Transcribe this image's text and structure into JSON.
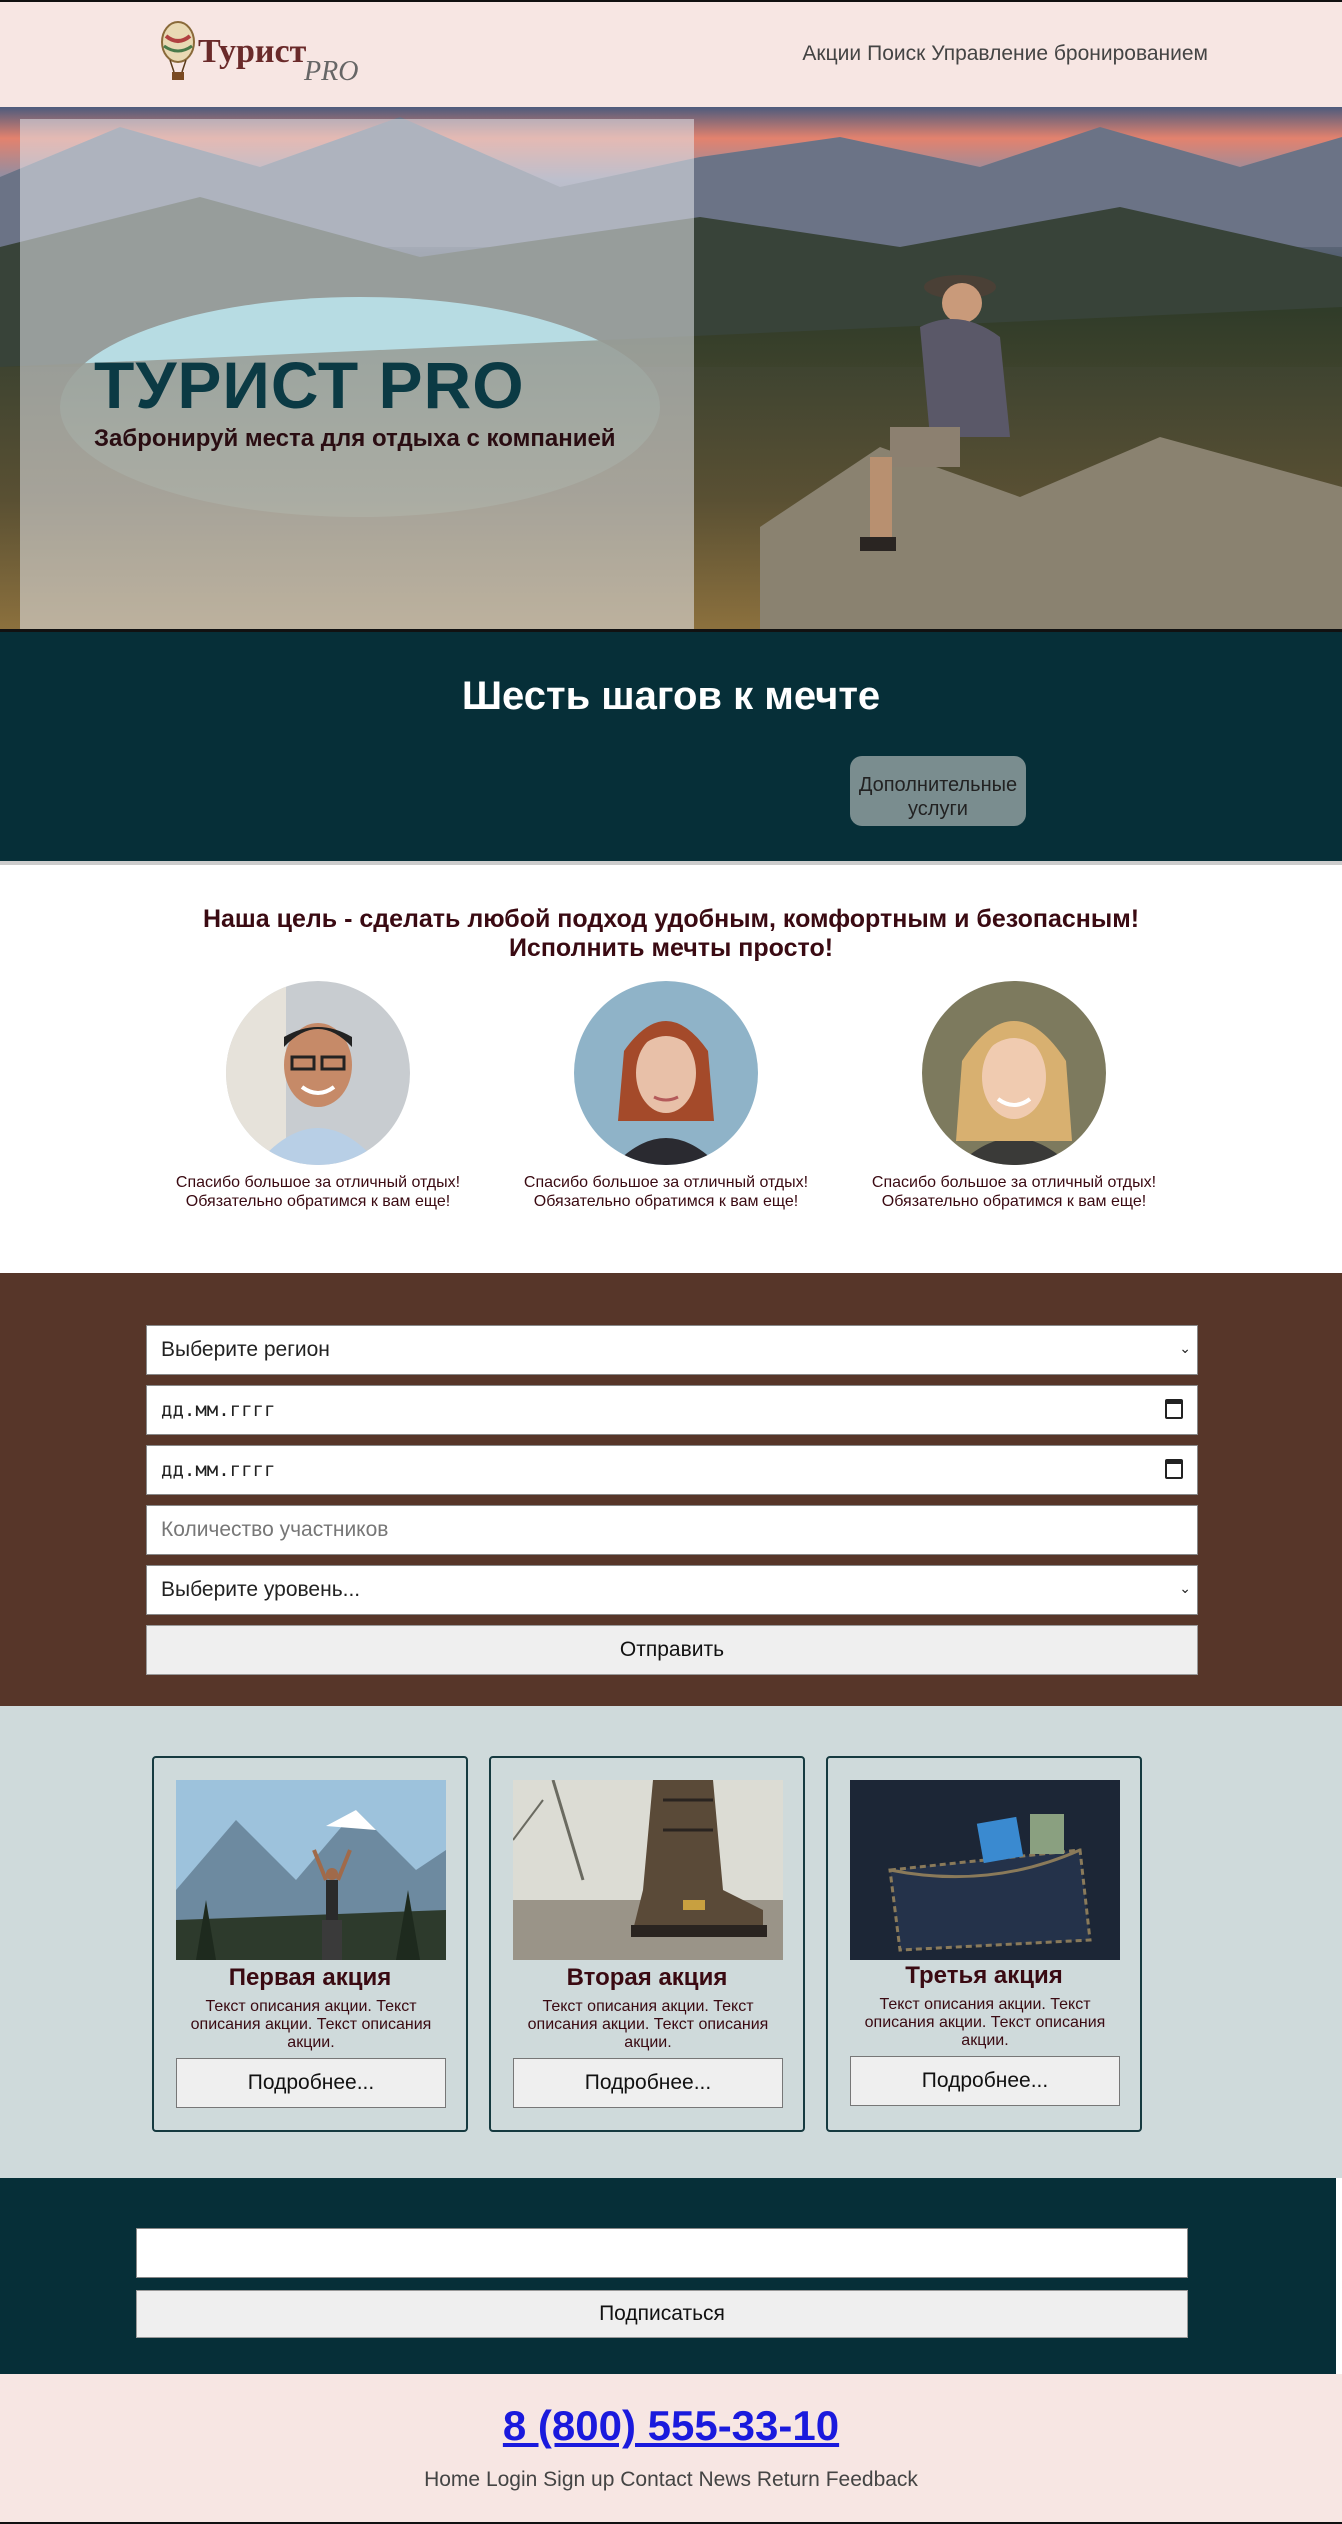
{
  "header": {
    "logo_text_main": "Турист",
    "logo_text_suffix": "PRO",
    "nav": [
      "Акции",
      "Поиск",
      "Управление бронированием"
    ]
  },
  "hero": {
    "title": "ТУРИСТ PRO",
    "subtitle": "Забронируй места для отдыха с компанией"
  },
  "steps": {
    "title": "Шесть шагов к мечте",
    "extra_button": "Дополнительные услуги"
  },
  "reviews": {
    "goal_line1": "Наша цель - сделать любой подход удобным, комфортным и безопасным!",
    "goal_line2": "Исполнить мечты просто!",
    "items": [
      {
        "line1": "Спасибо большое за отличный отдых!",
        "line2": "Обязательно обратимся к вам еще!"
      },
      {
        "line1": "Спасибо большое за отличный отдых!",
        "line2": "Обязательно обратимся к вам еще!"
      },
      {
        "line1": "Спасибо большое за отличный отдых!",
        "line2": "Обязательно обратимся к вам еще!"
      }
    ]
  },
  "form": {
    "region_select": "Выберите регион",
    "date_from_placeholder": "дд.мм.гггг",
    "date_to_placeholder": "дд.мм.гггг",
    "participants_placeholder": "Количество участников",
    "level_select": "Выберите уровень...",
    "submit_label": "Отправить"
  },
  "promos": [
    {
      "title": "Первая акция",
      "desc": "Текст описания акции. Текст описания акции. Текст описания акции.",
      "button": "Подробнее..."
    },
    {
      "title": "Вторая акция",
      "desc": "Текст описания акции. Текст описания акции. Текст описания акции.",
      "button": "Подробнее..."
    },
    {
      "title": "Третья акция",
      "desc": "Текст описания акции. Текст описания акции. Текст описания акции.",
      "button": "Подробнее..."
    }
  ],
  "subscribe": {
    "button": "Подписаться"
  },
  "footer": {
    "phone": "8 (800) 555-33-10",
    "links": [
      "Home",
      "Login",
      "Sign up",
      "Contact",
      "News",
      "Return",
      "Feedback"
    ]
  },
  "colors": {
    "header_bg": "#f7e6e3",
    "dark_teal": "#062f38",
    "form_brown": "#573629",
    "promo_bg": "#cfdadb",
    "heading_maroon": "#3a0a12"
  }
}
